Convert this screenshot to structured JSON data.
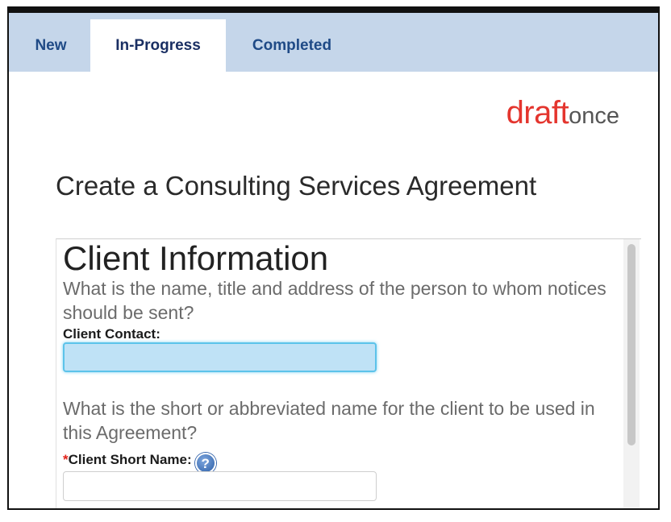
{
  "tabs": [
    {
      "label": "New",
      "active": false
    },
    {
      "label": "In-Progress",
      "active": true
    },
    {
      "label": "Completed",
      "active": false
    }
  ],
  "logo": {
    "part1": "draft",
    "part2": "once"
  },
  "page_title": "Create a Consulting Services Agreement",
  "section": {
    "title": "Client Information",
    "question1": "What is the name, title and address of the person to whom notices should be sent?",
    "field1_label": "Client Contact:",
    "field1_value": "",
    "question2": "What is the short or abbreviated name for the client to be used in this Agreement?",
    "field2_required_mark": "*",
    "field2_label": "Client Short Name:",
    "field2_help": "?",
    "field2_value": ""
  },
  "colors": {
    "tab_bar": "#c5d6ea",
    "tab_text": "#1f4a86",
    "logo_red": "#e4352e",
    "focused_input": "#bfe2f6",
    "required": "#e2231a"
  }
}
